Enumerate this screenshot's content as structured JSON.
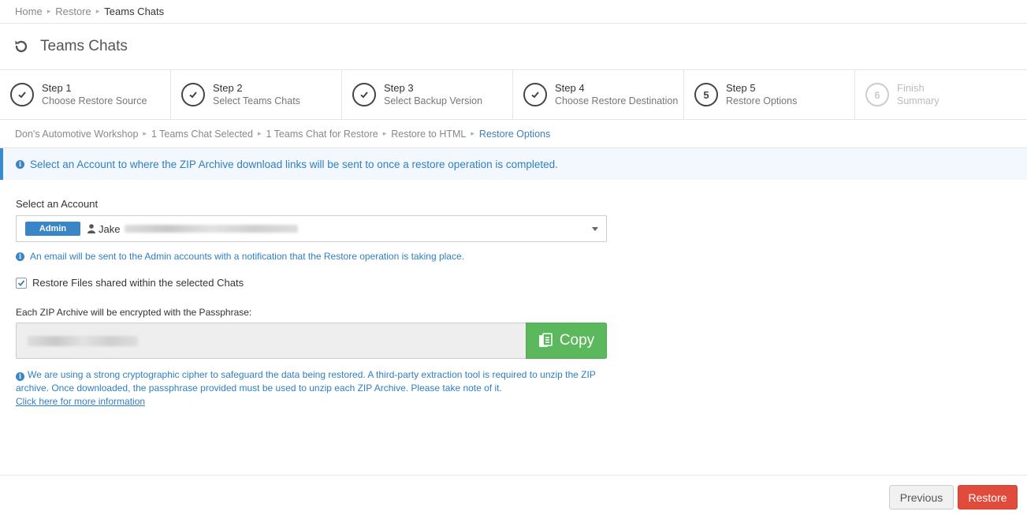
{
  "breadcrumb": [
    "Home",
    "Restore",
    "Teams Chats"
  ],
  "page_title": "Teams Chats",
  "steps": [
    {
      "title": "Step 1",
      "sub": "Choose Restore Source",
      "state": "done"
    },
    {
      "title": "Step 2",
      "sub": "Select Teams Chats",
      "state": "done"
    },
    {
      "title": "Step 3",
      "sub": "Select Backup Version",
      "state": "done"
    },
    {
      "title": "Step 4",
      "sub": "Choose Restore Destination",
      "state": "done"
    },
    {
      "title": "Step 5",
      "sub": "Restore Options",
      "state": "current",
      "num": "5"
    },
    {
      "title": "Finish",
      "sub": "Summary",
      "state": "disabled",
      "num": "6"
    }
  ],
  "path": [
    "Don's Automotive Workshop",
    "1 Teams Chat Selected",
    "1 Teams Chat for Restore",
    "Restore to HTML",
    "Restore Options"
  ],
  "info_banner": "Select an Account to where the ZIP Archive download links will be sent to once a restore operation is completed.",
  "account": {
    "label": "Select an Account",
    "badge": "Admin",
    "name": "Jake"
  },
  "admin_note": "An email will be sent to the Admin accounts with a notification that the Restore operation is taking place.",
  "restore_files": {
    "label": "Restore Files shared within the selected Chats",
    "checked": true
  },
  "passphrase": {
    "label": "Each ZIP Archive will be encrypted with the Passphrase:",
    "copy_label": "Copy"
  },
  "cipher_note": "We are using a strong cryptographic cipher to safeguard the data being restored. A third-party extraction tool is required to unzip the ZIP archive. Once downloaded, the passphrase provided must be used to unzip each ZIP Archive. Please take note of it.",
  "more_info_link": "Click here for more information",
  "footer": {
    "previous": "Previous",
    "restore": "Restore"
  },
  "colors": {
    "accent": "#3a85c6",
    "success": "#5cb85c",
    "danger": "#e04b3c"
  }
}
